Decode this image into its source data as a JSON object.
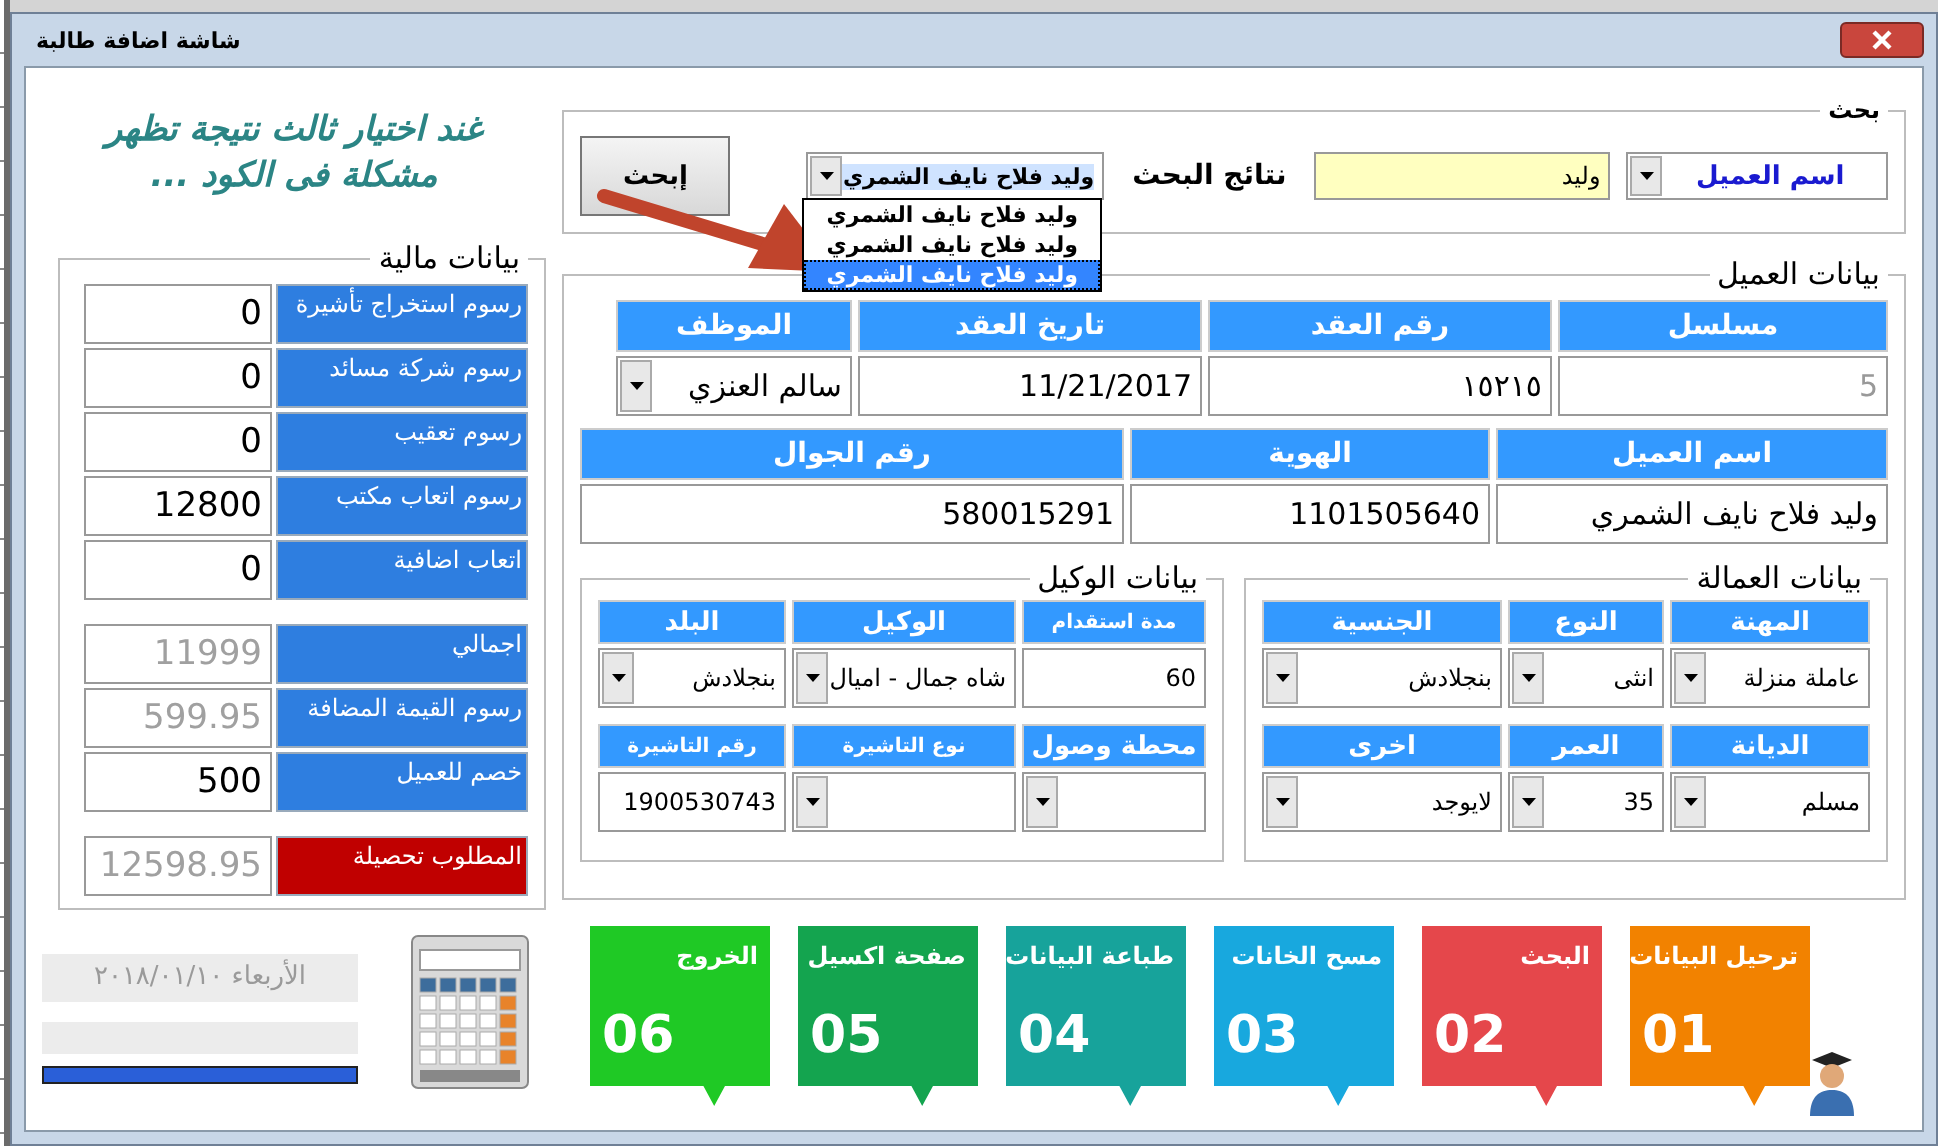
{
  "window": {
    "title": "شاشة اضافة طالبة"
  },
  "annotation": {
    "text": "غند اختيار ثالث نتيجة تظهر مشكلة فى الكود ..."
  },
  "search": {
    "title": "بحث",
    "field_select": "اسم العميل",
    "query": "وليد",
    "results_label": "نتائج البحث",
    "result_value": "وليد فلاح نايف الشمري",
    "expanded": true,
    "results": [
      {
        "label": "وليد فلاح نايف الشمري",
        "selected": false
      },
      {
        "label": "وليد فلاح نايف الشمري",
        "selected": false
      },
      {
        "label": "وليد فلاح نايف الشمري",
        "selected": true
      }
    ],
    "button": "إبحث"
  },
  "finance": {
    "title": "بيانات مالية",
    "rows": [
      {
        "label": "رسوم استخراج تأشيرة",
        "value": "0",
        "kind": "input"
      },
      {
        "label": "رسوم شركة مسائد",
        "value": "0",
        "kind": "input"
      },
      {
        "label": "رسوم تعقيب",
        "value": "0",
        "kind": "input"
      },
      {
        "label": "رسوم اتعاب مكتب",
        "value": "12800",
        "kind": "input"
      },
      {
        "label": "اتعاب اضافية",
        "value": "0",
        "kind": "input"
      },
      {
        "label": "اجمالي",
        "value": "11999",
        "kind": "computed"
      },
      {
        "label": "رسوم القيمة المضافة",
        "value": "599.95",
        "kind": "computed"
      },
      {
        "label": "خصم للعميل",
        "value": "500",
        "kind": "input"
      },
      {
        "label": "المطلوب تحصيلة",
        "value": "12598.95",
        "kind": "due"
      }
    ]
  },
  "customer": {
    "title": "بيانات العميل",
    "row_1": [
      {
        "label": "مسلسل",
        "value": "5",
        "kind": "readonly"
      },
      {
        "label": "رقم العقد",
        "value": "١٥٢١٥",
        "kind": "text"
      },
      {
        "label": "تاريخ العقد",
        "value": "11/21/2017",
        "kind": "text"
      },
      {
        "label": "الموظف",
        "value": "سالم العنزي",
        "kind": "combo"
      }
    ],
    "row_2": [
      {
        "label": "اسم العميل",
        "value": "وليد فلاح نايف الشمري",
        "kind": "text"
      },
      {
        "label": "الهوية",
        "value": "1101505640",
        "kind": "text"
      },
      {
        "label": "رقم الجوال",
        "value": "580015291",
        "kind": "text"
      }
    ]
  },
  "labour": {
    "title": "بيانات العمالة",
    "fields": [
      {
        "label": "المهنة",
        "value": "عاملة منزلة",
        "kind": "combo"
      },
      {
        "label": "النوع",
        "value": "انثى",
        "kind": "combo"
      },
      {
        "label": "الجنسية",
        "value": "بنجلادش",
        "kind": "combo"
      },
      {
        "label": "الديانة",
        "value": "مسلم",
        "kind": "combo"
      },
      {
        "label": "العمر",
        "value": "35",
        "kind": "combo"
      },
      {
        "label": "اخرى",
        "value": "لايوجد",
        "kind": "combo"
      }
    ]
  },
  "agent": {
    "title": "بيانات الوكيل",
    "fields": [
      {
        "label": "مدة استقدام",
        "value": "60",
        "kind": "text"
      },
      {
        "label": "الوكيل",
        "value": "شاه جمال - اميال",
        "kind": "combo"
      },
      {
        "label": "البلد",
        "value": "بنجلادش",
        "kind": "combo"
      },
      {
        "label": "محطة وصول",
        "kind": "combo"
      },
      {
        "label": "نوع التاشيرة",
        "kind": "combo"
      },
      {
        "label": "رقم التاشيرة",
        "value": "1900530743",
        "kind": "text"
      }
    ]
  },
  "date_text": "الأربعاء  ٢٠١٨/٠١/١٠",
  "progress": {
    "level": 1
  },
  "tiles": [
    {
      "label": "ترحيل البيانات",
      "number": "01",
      "color": "#f28200"
    },
    {
      "label": "البحث",
      "number": "02",
      "color": "#e5474b"
    },
    {
      "label": "مسح الخانات",
      "number": "03",
      "color": "#18a8de"
    },
    {
      "label": "طباعة البيانات",
      "number": "04",
      "color": "#17a39b"
    },
    {
      "label": "صفحة اكسيل",
      "number": "05",
      "color": "#14a44f"
    },
    {
      "label": "الخروج",
      "number": "06",
      "color": "#1fc925"
    }
  ]
}
